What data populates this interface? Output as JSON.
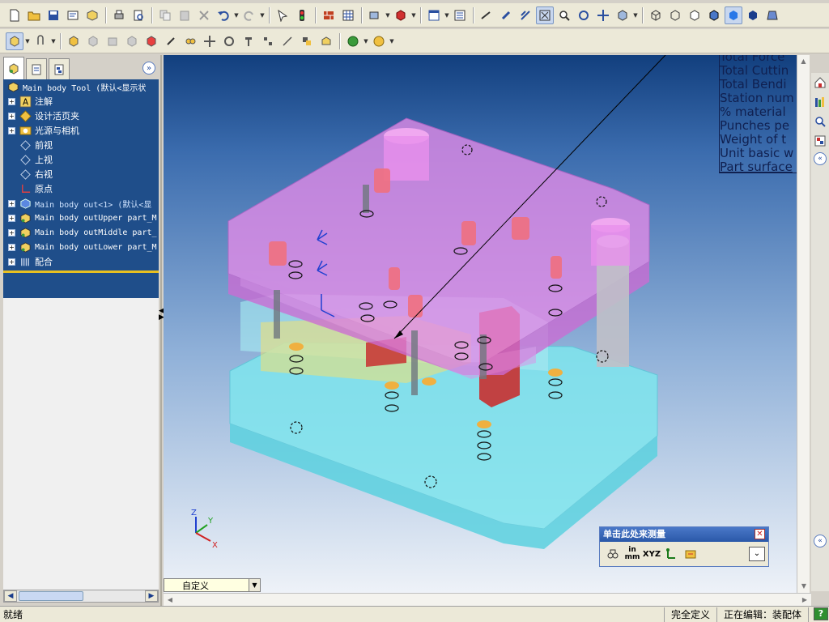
{
  "tree": {
    "root_label": "Main body Tool  (默认<显示状",
    "items": [
      {
        "label": "注解",
        "icon": "annotation-icon",
        "expandable": true
      },
      {
        "label": "设计活页夹",
        "icon": "design-binder-icon",
        "expandable": true
      },
      {
        "label": "光源与相机",
        "icon": "lights-cameras-icon",
        "expandable": true
      },
      {
        "label": "前视",
        "icon": "plane-icon",
        "expandable": false
      },
      {
        "label": "上视",
        "icon": "plane-icon",
        "expandable": false
      },
      {
        "label": "右视",
        "icon": "plane-icon",
        "expandable": false
      },
      {
        "label": "原点",
        "icon": "origin-icon",
        "expandable": false
      },
      {
        "label": "Main body out<1> (默认<显",
        "icon": "component-icon",
        "expandable": true,
        "selected": true
      },
      {
        "label": "Main body outUpper part_M",
        "icon": "subassembly-icon",
        "expandable": true
      },
      {
        "label": "Main body outMiddle part_",
        "icon": "subassembly-icon",
        "expandable": true
      },
      {
        "label": "Main body outLower part_M",
        "icon": "subassembly-icon",
        "expandable": true
      },
      {
        "label": "配合",
        "icon": "mates-icon",
        "expandable": true
      }
    ]
  },
  "properties_overlay": {
    "lines": [
      "Total Force",
      "Total Cuttin",
      "Total Bendi",
      "Station num",
      "% material",
      "Punches pe",
      "Weight of t",
      "Unit basic w",
      "Part surface"
    ]
  },
  "measure_panel": {
    "title": "单击此处来测量",
    "units_label_top": "in",
    "units_label_bottom": "mm",
    "xyz_label": "XYZ"
  },
  "configuration": {
    "value": "自定义"
  },
  "statusbar": {
    "left": "就绪",
    "definition": "完全定义",
    "editing": "正在编辑：装配体",
    "help": "?"
  },
  "colors": {
    "tree_bg": "#1f4e8a",
    "viewport_top": "#123f7e",
    "viewport_bottom": "#eef2f8",
    "upper_plate": "#e48be8",
    "lower_plate": "#7fe6ee",
    "die_block": "#c83030",
    "measure_title": "#2a58a8"
  },
  "triad_labels": {
    "x": "X",
    "y": "Y",
    "z": "Z"
  }
}
